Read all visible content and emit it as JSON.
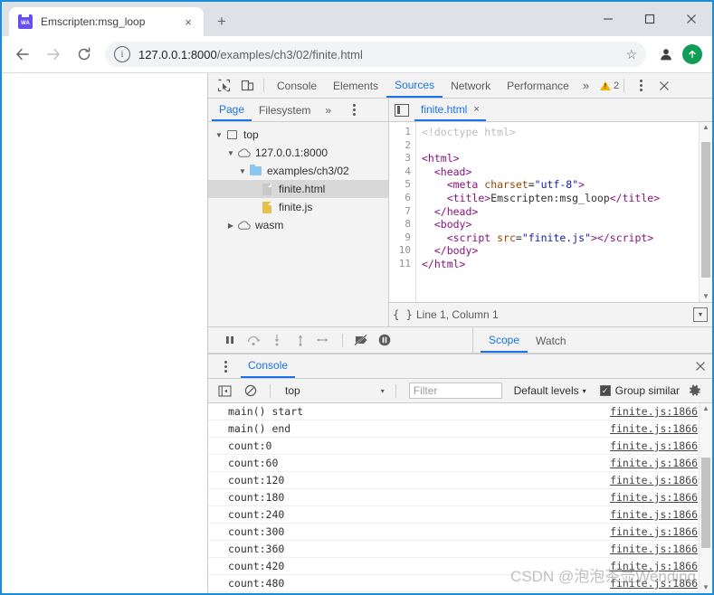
{
  "browser": {
    "tab": {
      "title": "Emscripten:msg_loop",
      "favicon_label": "WA",
      "close_label": "×"
    },
    "new_tab_label": "+",
    "window_controls": {
      "minimize": "—",
      "maximize": "□",
      "close": "×"
    },
    "toolbar": {
      "back_label": "←",
      "forward_label": "→",
      "reload_label": "↻",
      "info_label": "i",
      "url_host": "127.0.0.1:8000",
      "url_path": "/examples/ch3/02/finite.html",
      "star_label": "☆",
      "avatar_label": "●",
      "update_label": "↑"
    }
  },
  "devtools": {
    "tabs": [
      {
        "label": "Console",
        "active": false
      },
      {
        "label": "Elements",
        "active": false
      },
      {
        "label": "Sources",
        "active": true
      },
      {
        "label": "Network",
        "active": false
      },
      {
        "label": "Performance",
        "active": false
      }
    ],
    "more_label": "»",
    "warning_count": "2",
    "close_label": "×",
    "sources": {
      "nav_tabs": [
        {
          "label": "Page",
          "active": true
        },
        {
          "label": "Filesystem",
          "active": false
        }
      ],
      "nav_more_label": "»",
      "tree": [
        {
          "label": "top",
          "icon": "frame-icon",
          "indent": 0,
          "expanded": true,
          "selected": false
        },
        {
          "label": "127.0.0.1:8000",
          "icon": "cloud-icon",
          "indent": 1,
          "expanded": true,
          "selected": false
        },
        {
          "label": "examples/ch3/02",
          "icon": "folder-icon",
          "indent": 2,
          "expanded": true,
          "selected": false
        },
        {
          "label": "finite.html",
          "icon": "document-icon",
          "indent": 3,
          "expanded": null,
          "selected": true
        },
        {
          "label": "finite.js",
          "icon": "js-file-icon",
          "indent": 3,
          "expanded": null,
          "selected": false
        },
        {
          "label": "wasm",
          "icon": "cloud-icon",
          "indent": 1,
          "expanded": false,
          "selected": false
        }
      ],
      "editor_tab": {
        "label": "finite.html",
        "close_label": "×"
      },
      "code_lines": [
        {
          "n": "1",
          "html": "<span class=\"c-doctype\">&lt;!doctype html&gt;</span>"
        },
        {
          "n": "2",
          "html": ""
        },
        {
          "n": "3",
          "html": "<span class=\"c-tag\">&lt;html&gt;</span>"
        },
        {
          "n": "4",
          "html": "  <span class=\"c-tag\">&lt;head&gt;</span>"
        },
        {
          "n": "5",
          "html": "    <span class=\"c-tag\">&lt;meta</span> <span class=\"c-attr\">charset</span>=<span class=\"c-val\">\"utf-8\"</span><span class=\"c-tag\">&gt;</span>"
        },
        {
          "n": "6",
          "html": "    <span class=\"c-tag\">&lt;title&gt;</span><span class=\"c-txt\">Emscripten:msg_loop</span><span class=\"c-tag\">&lt;/title&gt;</span>"
        },
        {
          "n": "7",
          "html": "  <span class=\"c-tag\">&lt;/head&gt;</span>"
        },
        {
          "n": "8",
          "html": "  <span class=\"c-tag\">&lt;body&gt;</span>"
        },
        {
          "n": "9",
          "html": "    <span class=\"c-tag\">&lt;script</span> <span class=\"c-attr\">src</span>=<span class=\"c-val\">\"finite.js\"</span><span class=\"c-tag\">&gt;&lt;/script&gt;</span>"
        },
        {
          "n": "10",
          "html": "  <span class=\"c-tag\">&lt;/body&gt;</span>"
        },
        {
          "n": "11",
          "html": "<span class=\"c-tag\">&lt;/html&gt;</span>"
        }
      ],
      "status_format_label": "{ }",
      "status_position": "Line 1, Column 1"
    },
    "debugger": {
      "buttons": [
        "pause-button",
        "step-over-button",
        "step-into-button",
        "step-out-button",
        "step-button",
        "deactivate-breakpoints-button",
        "pause-on-exceptions-button"
      ],
      "tabs": [
        {
          "label": "Scope",
          "active": true
        },
        {
          "label": "Watch",
          "active": false
        }
      ]
    },
    "console": {
      "drawer_tab": "Console",
      "drawer_close_label": "×",
      "context": "top",
      "context_caret": "▾",
      "filter_placeholder": "Filter",
      "levels_label": "Default levels",
      "levels_caret": "▾",
      "group_similar_label": "Group similar",
      "group_similar_checked": true,
      "messages": [
        {
          "text": "main() start",
          "source": "finite.js:1866"
        },
        {
          "text": "main() end",
          "source": "finite.js:1866"
        },
        {
          "text": "count:0",
          "source": "finite.js:1866"
        },
        {
          "text": "count:60",
          "source": "finite.js:1866"
        },
        {
          "text": "count:120",
          "source": "finite.js:1866"
        },
        {
          "text": "count:180",
          "source": "finite.js:1866"
        },
        {
          "text": "count:240",
          "source": "finite.js:1866"
        },
        {
          "text": "count:300",
          "source": "finite.js:1866"
        },
        {
          "text": "count:360",
          "source": "finite.js:1866"
        },
        {
          "text": "count:420",
          "source": "finite.js:1866"
        },
        {
          "text": "count:480",
          "source": "finite.js:1866"
        }
      ]
    }
  },
  "watermark": "CSDN @泡泡茶壶Wending"
}
